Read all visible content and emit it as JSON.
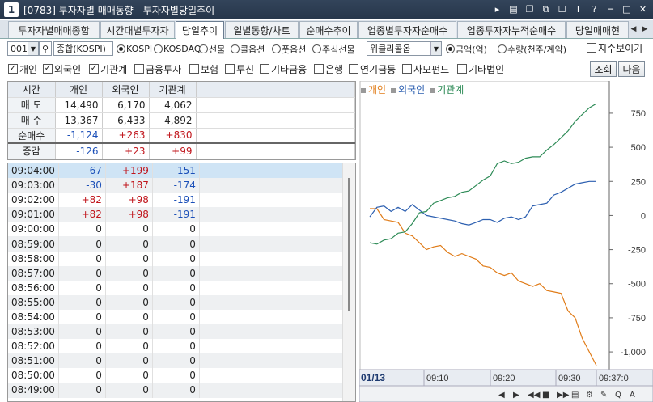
{
  "window": {
    "num": "1",
    "title": "[0783] 투자자별 매매동향 - 투자자별당일추이"
  },
  "tabs": [
    {
      "label": "투자자별매매종합"
    },
    {
      "label": "시간대별투자자"
    },
    {
      "label": "당일추이"
    },
    {
      "label": "일별동향/차트"
    },
    {
      "label": "순매수추이"
    },
    {
      "label": "업종별투자자순매수"
    },
    {
      "label": "업종투자자누적순매수"
    },
    {
      "label": "당일매매현"
    }
  ],
  "controls": {
    "code": "001",
    "market": "종합(KOSPI)",
    "radio_market": [
      "KOSPI",
      "KOSDAQ",
      "선물",
      "콜옵션",
      "풋옵션",
      "주식선물",
      "위클리콜옵"
    ],
    "radio_unit": [
      "금액(억)",
      "수량(천주/계약)"
    ],
    "index_check": "지수보이기"
  },
  "checks": {
    "items": [
      {
        "label": "개인",
        "checked": true
      },
      {
        "label": "외국인",
        "checked": true
      },
      {
        "label": "기관계",
        "checked": true
      },
      {
        "label": "금융투자",
        "checked": false
      },
      {
        "label": "보험",
        "checked": false
      },
      {
        "label": "투신",
        "checked": false
      },
      {
        "label": "기타금융",
        "checked": false
      },
      {
        "label": "은행",
        "checked": false
      },
      {
        "label": "연기금등",
        "checked": false
      },
      {
        "label": "사모펀드",
        "checked": false
      },
      {
        "label": "기타법인",
        "checked": false
      }
    ],
    "query_button": "조회",
    "next_button": "다음"
  },
  "summary": {
    "headers": [
      "시간",
      "개인",
      "외국인",
      "기관계"
    ],
    "rows": [
      {
        "label": "매 도",
        "v": [
          "14,490",
          "6,170",
          "4,062"
        ],
        "c": [
          "",
          "",
          ""
        ]
      },
      {
        "label": "매 수",
        "v": [
          "13,367",
          "6,433",
          "4,892"
        ],
        "c": [
          "",
          "",
          ""
        ]
      },
      {
        "label": "순매수",
        "v": [
          "-1,124",
          "+263",
          "+830"
        ],
        "c": [
          "neg",
          "pos",
          "pos"
        ]
      },
      {
        "label": "증감",
        "v": [
          "-126",
          "+23",
          "+99"
        ],
        "c": [
          "neg",
          "pos",
          "pos"
        ]
      }
    ]
  },
  "timelist": [
    {
      "t": "09:04:00",
      "v": [
        "-67",
        "+199",
        "-151"
      ],
      "c": [
        "neg",
        "pos",
        "neg"
      ]
    },
    {
      "t": "09:03:00",
      "v": [
        "-30",
        "+187",
        "-174"
      ],
      "c": [
        "neg",
        "pos",
        "neg"
      ]
    },
    {
      "t": "09:02:00",
      "v": [
        "+82",
        "+98",
        "-191"
      ],
      "c": [
        "pos",
        "pos",
        "neg"
      ]
    },
    {
      "t": "09:01:00",
      "v": [
        "+82",
        "+98",
        "-191"
      ],
      "c": [
        "pos",
        "pos",
        "neg"
      ]
    },
    {
      "t": "09:00:00",
      "v": [
        "0",
        "0",
        "0"
      ],
      "c": [
        "",
        "",
        ""
      ]
    },
    {
      "t": "08:59:00",
      "v": [
        "0",
        "0",
        "0"
      ],
      "c": [
        "",
        "",
        ""
      ]
    },
    {
      "t": "08:58:00",
      "v": [
        "0",
        "0",
        "0"
      ],
      "c": [
        "",
        "",
        ""
      ]
    },
    {
      "t": "08:57:00",
      "v": [
        "0",
        "0",
        "0"
      ],
      "c": [
        "",
        "",
        ""
      ]
    },
    {
      "t": "08:56:00",
      "v": [
        "0",
        "0",
        "0"
      ],
      "c": [
        "",
        "",
        ""
      ]
    },
    {
      "t": "08:55:00",
      "v": [
        "0",
        "0",
        "0"
      ],
      "c": [
        "",
        "",
        ""
      ]
    },
    {
      "t": "08:54:00",
      "v": [
        "0",
        "0",
        "0"
      ],
      "c": [
        "",
        "",
        ""
      ]
    },
    {
      "t": "08:53:00",
      "v": [
        "0",
        "0",
        "0"
      ],
      "c": [
        "",
        "",
        ""
      ]
    },
    {
      "t": "08:52:00",
      "v": [
        "0",
        "0",
        "0"
      ],
      "c": [
        "",
        "",
        ""
      ]
    },
    {
      "t": "08:51:00",
      "v": [
        "0",
        "0",
        "0"
      ],
      "c": [
        "",
        "",
        ""
      ]
    },
    {
      "t": "08:50:00",
      "v": [
        "0",
        "0",
        "0"
      ],
      "c": [
        "",
        "",
        ""
      ]
    },
    {
      "t": "08:49:00",
      "v": [
        "0",
        "0",
        "0"
      ],
      "c": [
        "",
        "",
        ""
      ]
    }
  ],
  "chart_data": {
    "type": "line",
    "date_label": "01/13",
    "x_ticks": [
      "09:10",
      "09:20",
      "09:30",
      "09:37:0"
    ],
    "y_ticks": [
      750,
      500,
      250,
      0,
      -250,
      -500,
      -750,
      -1000
    ],
    "y_tick_labels": [
      "750",
      "500",
      "250",
      "0",
      "-250",
      "-500",
      "-750",
      "-1,000"
    ],
    "ylim": [
      -1130,
      880
    ],
    "series": [
      {
        "name": "개인",
        "color": "#e07b17",
        "values": [
          50,
          50,
          -30,
          -40,
          -50,
          -130,
          -150,
          -200,
          -250,
          -230,
          -220,
          -270,
          -300,
          -280,
          -300,
          -320,
          -370,
          -380,
          -420,
          -440,
          -420,
          -480,
          -500,
          -520,
          -500,
          -550,
          -560,
          -570,
          -700,
          -750,
          -900,
          -1000,
          -1100
        ]
      },
      {
        "name": "외국인",
        "color": "#2c5fb0",
        "values": [
          -10,
          60,
          70,
          30,
          60,
          30,
          80,
          40,
          0,
          -10,
          -20,
          -30,
          -40,
          -60,
          -70,
          -50,
          -30,
          -30,
          -50,
          -20,
          -10,
          -30,
          -10,
          70,
          80,
          90,
          150,
          170,
          200,
          230,
          240,
          250,
          250
        ]
      },
      {
        "name": "기관계",
        "color": "#2e8b57",
        "values": [
          -200,
          -210,
          -180,
          -170,
          -130,
          -120,
          -60,
          20,
          30,
          90,
          110,
          130,
          140,
          170,
          180,
          220,
          260,
          290,
          380,
          400,
          380,
          390,
          420,
          430,
          430,
          480,
          520,
          570,
          620,
          690,
          740,
          790,
          820
        ]
      }
    ]
  }
}
